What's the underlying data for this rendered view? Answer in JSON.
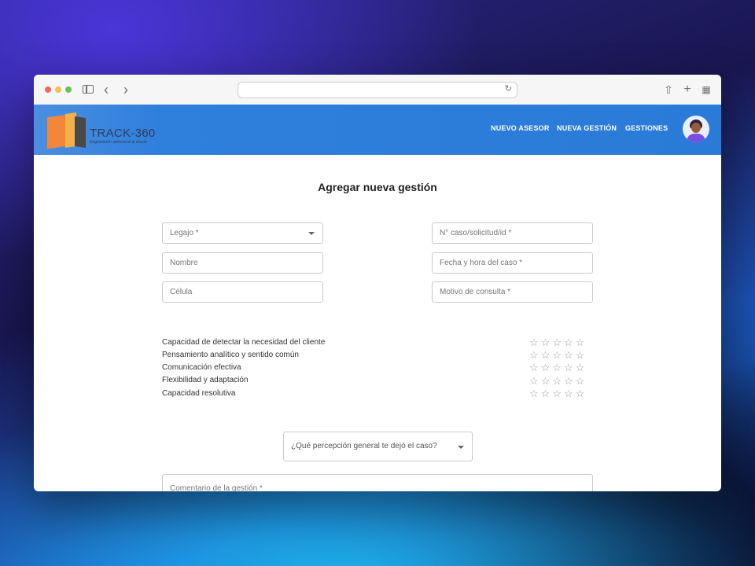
{
  "app": {
    "logo_title": "TRACK-360",
    "logo_subtitle": "Seguimiento atencional al cliente"
  },
  "nav": {
    "items": [
      {
        "label": "NUEVO ASESOR"
      },
      {
        "label": "NUEVA GESTIÓN"
      },
      {
        "label": "GESTIONES"
      }
    ]
  },
  "page": {
    "title": "Agregar nueva gestión"
  },
  "form": {
    "legajo": {
      "placeholder": "Legajo *"
    },
    "nombre": {
      "placeholder": "Nombre"
    },
    "celula": {
      "placeholder": "Célula"
    },
    "caso": {
      "placeholder": "N° caso/solicitud/id *"
    },
    "fecha": {
      "placeholder": "Fecha y hora del caso *"
    },
    "motivo": {
      "placeholder": "Motivo de consulta *"
    },
    "criteria": [
      {
        "label": "Capacidad de detectar la necesidad del cliente",
        "rating": 0,
        "max": 5
      },
      {
        "label": "Pensamiento analítico y sentido común",
        "rating": 0,
        "max": 5
      },
      {
        "label": "Comunicación efectiva",
        "rating": 0,
        "max": 5
      },
      {
        "label": "Flexibilidad y adaptación",
        "rating": 0,
        "max": 5
      },
      {
        "label": "Capacidad resolutiva",
        "rating": 0,
        "max": 5
      }
    ],
    "perception": {
      "placeholder": "¿Qué percepción general te dejó el caso?"
    },
    "comment": {
      "placeholder": "Comentario de la gestión *"
    }
  },
  "icons": {
    "star": "☆",
    "back": "‹",
    "forward": "›",
    "reload": "↻",
    "share": "⇧",
    "new_tab": "+",
    "tabs": "▦"
  },
  "colors": {
    "header": "#2a7bd8",
    "logo_orange": "#f2873a",
    "logo_yellow": "#f5b04a"
  }
}
